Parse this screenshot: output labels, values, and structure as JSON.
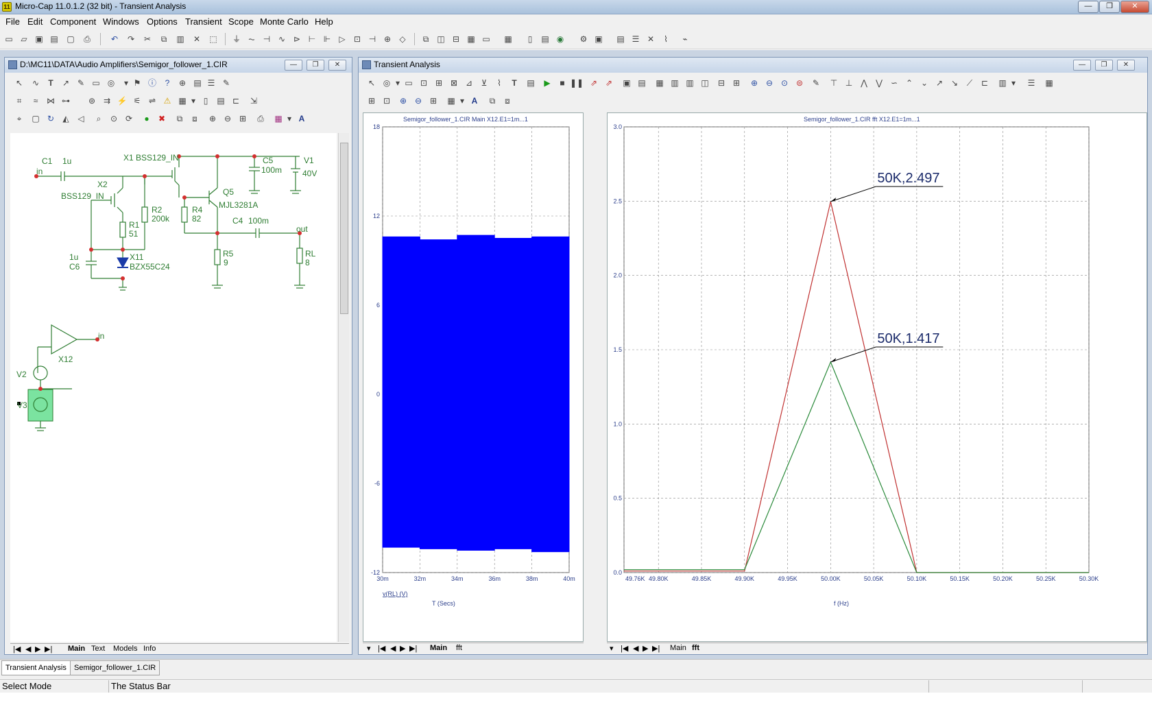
{
  "app": {
    "title": "Micro-Cap 11.0.1.2 (32 bit) - Transient Analysis",
    "icon_label": "11"
  },
  "window_controls": {
    "minimize": "—",
    "maximize": "❐",
    "close": "✕"
  },
  "menu": [
    "File",
    "Edit",
    "Component",
    "Windows",
    "Options",
    "Transient",
    "Scope",
    "Monte Carlo",
    "Help"
  ],
  "schematic_window": {
    "title": "D:\\MC11\\DATA\\Audio Amplifiers\\Semigor_follower_1.CIR",
    "tabs": [
      "Main",
      "Text",
      "Models",
      "Info"
    ],
    "active_tab": "Main",
    "labels": {
      "c1": "C1",
      "c1_val": "1u",
      "in1": "in",
      "x1": "X1 BSS129_IN",
      "x2": "X2",
      "x2_model": "BSS129_IN",
      "c5": "C5",
      "c5_val": "100m",
      "v1": "V1",
      "v1_val": "40V",
      "q5": "Q5",
      "q5_model": "MJL3281A",
      "r2": "R2",
      "r2_val": "200k",
      "r4": "R4",
      "r4_val": "82",
      "r1": "R1",
      "r1_val": "51",
      "c4": "C4",
      "c4_val": "100m",
      "out": "out",
      "c6_val": "1u",
      "c6": "C6",
      "x11": "X11",
      "x11_model": "BZX55C24",
      "r5": "R5",
      "r5_val": "9",
      "rl": "RL",
      "rl_val": "8",
      "x12": "X12",
      "in2": "in",
      "v2": "V2",
      "v3": "V3"
    }
  },
  "transient_window": {
    "title": "Transient Analysis",
    "tabs": [
      "Main",
      "fft"
    ],
    "active_tab": "Main"
  },
  "fft_panel": {
    "tabs": [
      "Main",
      "fft"
    ],
    "active_tab": "fft"
  },
  "chart_data": [
    {
      "type": "area",
      "title": "Semigor_follower_1.CIR Main X12.E1=1m...1",
      "xlabel": "T (Secs)",
      "ylabel": "v(RL) (V)",
      "x_ticks": [
        "30m",
        "32m",
        "34m",
        "36m",
        "38m",
        "40m"
      ],
      "y_ticks": [
        "18",
        "12",
        "6",
        "0",
        "-6",
        "-12"
      ],
      "xlim": [
        30,
        40
      ],
      "ylim": [
        -12,
        18
      ],
      "grid": true,
      "series": [
        {
          "envelope_upper": [
            10.6,
            10.6,
            10.4,
            10.4,
            10.7,
            10.7,
            10.5,
            10.5,
            10.6,
            10.6,
            10.4
          ],
          "envelope_lower": [
            -10.3,
            -10.3,
            -10.4,
            -10.4,
            -10.5,
            -10.5,
            -10.4,
            -10.4,
            -10.6,
            -10.6,
            -10.5
          ],
          "color": "#0000ff"
        }
      ]
    },
    {
      "type": "line",
      "title": "Semigor_follower_1.CIR fft X12.E1=1m...1",
      "xlabel": "f (Hz)",
      "x_ticks": [
        "49.76K",
        "49.80K",
        "49.85K",
        "49.90K",
        "49.95K",
        "50.00K",
        "50.05K",
        "50.10K",
        "50.15K",
        "50.20K",
        "50.25K",
        "50.30K"
      ],
      "y_ticks": [
        "3.0",
        "2.5",
        "2.0",
        "1.5",
        "1.0",
        "0.5",
        "0.0"
      ],
      "xlim": [
        49.76,
        50.3
      ],
      "ylim": [
        0,
        3
      ],
      "grid": true,
      "x": [
        49.76,
        49.9,
        50.0,
        50.1,
        50.3
      ],
      "series": [
        {
          "values": [
            0.01,
            0.01,
            2.497,
            0.0,
            0.0
          ],
          "color": "#c03030"
        },
        {
          "values": [
            0.02,
            0.02,
            1.417,
            0.0,
            0.0
          ],
          "color": "#2a8a3a"
        }
      ],
      "annotations": [
        {
          "text": "50K,2.497",
          "x": 50.0,
          "y": 2.497
        },
        {
          "text": "50K,1.417",
          "x": 50.0,
          "y": 1.417
        }
      ]
    }
  ],
  "doc_tabs": [
    "Transient Analysis",
    "Semigor_follower_1.CIR"
  ],
  "status": {
    "mode": "Select Mode",
    "message": "The Status Bar"
  }
}
